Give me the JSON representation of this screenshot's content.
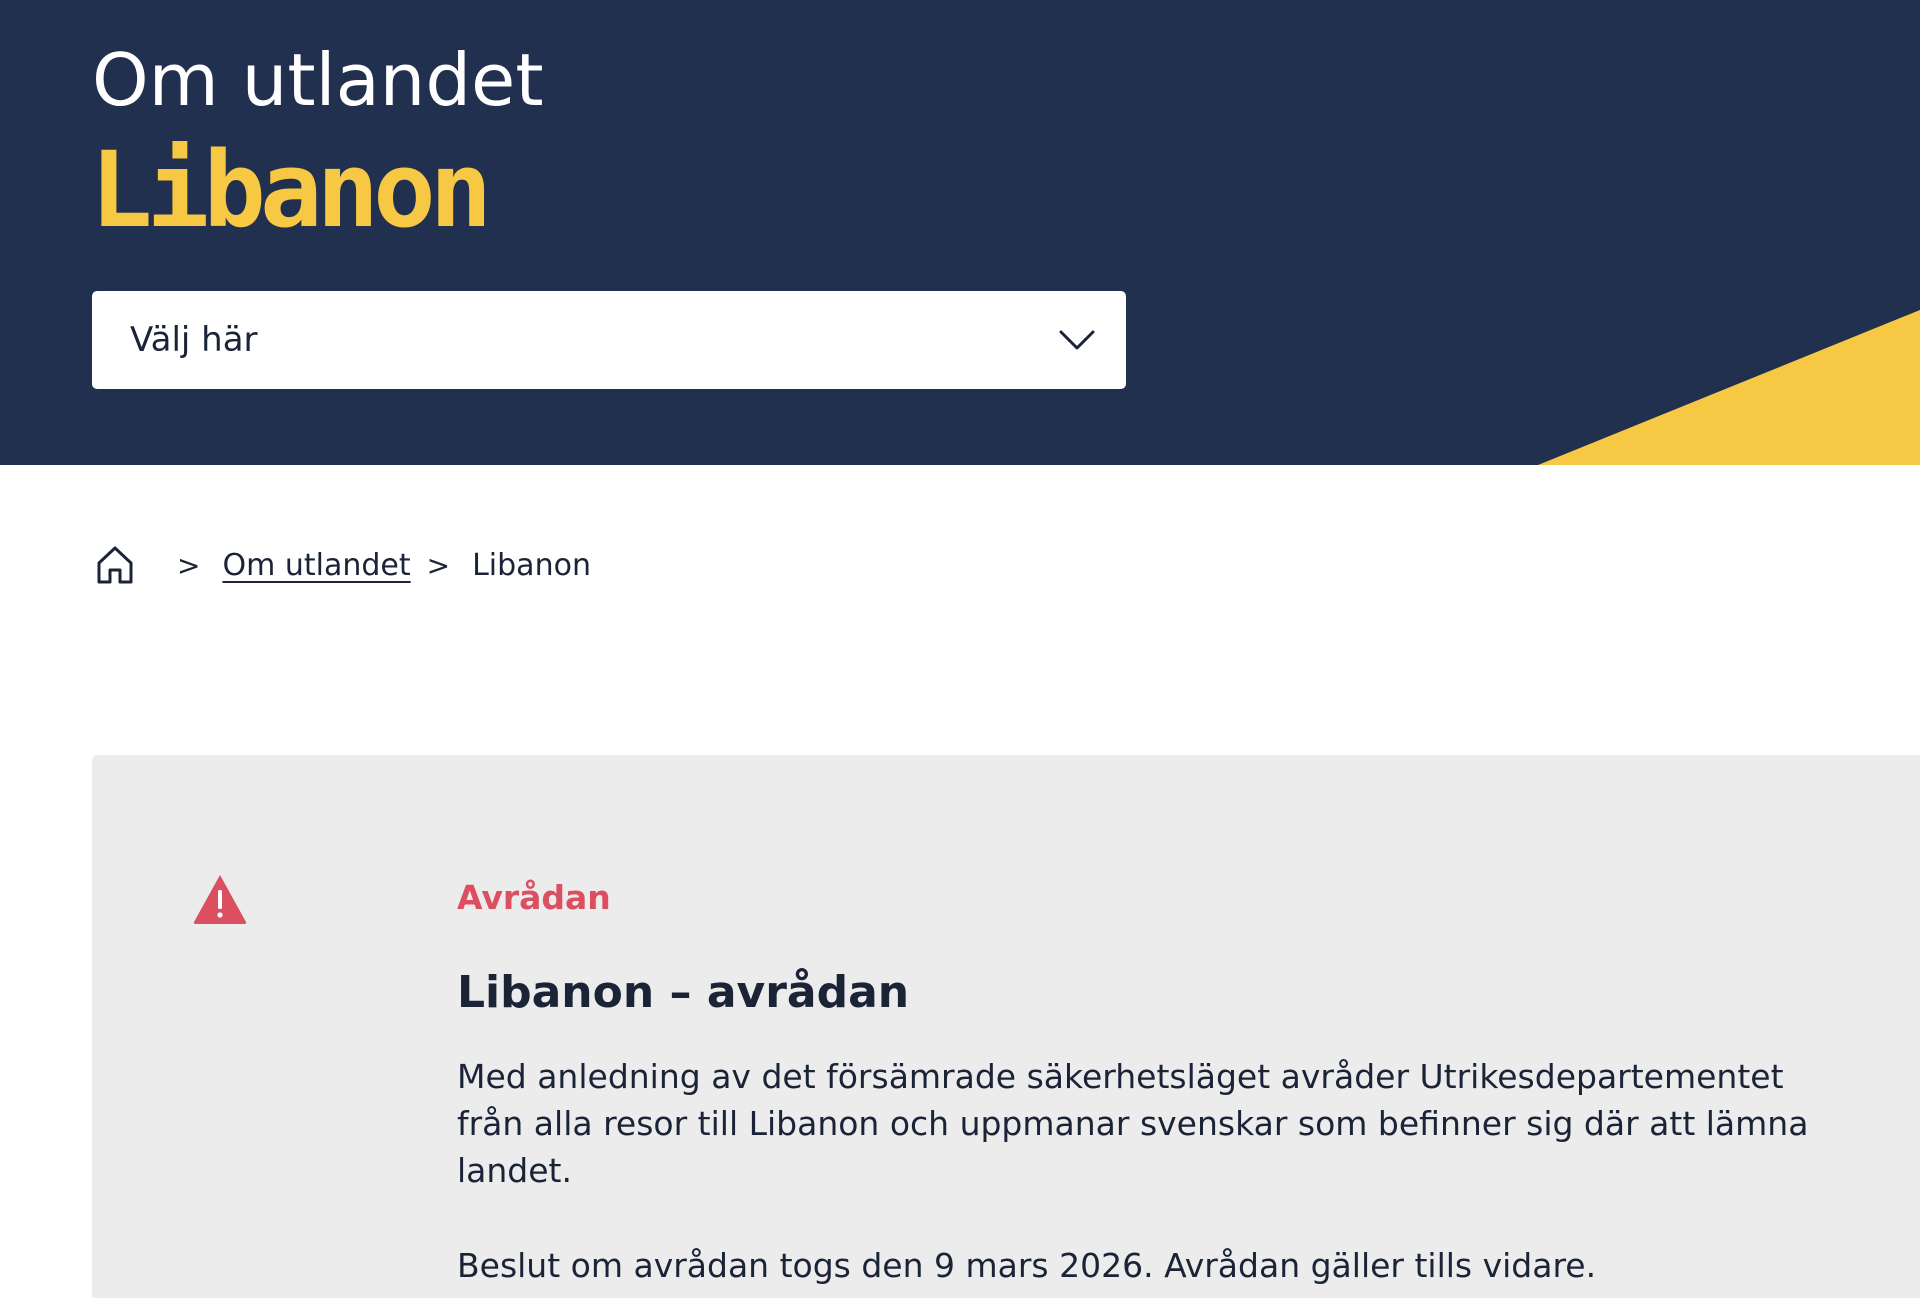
{
  "hero": {
    "kicker": "Om utlandet",
    "title": "Libanon",
    "colors": {
      "background": "#21304f",
      "accent": "#f6c844"
    },
    "select": {
      "value": "Välj här",
      "icon": "chevron-down-icon"
    }
  },
  "breadcrumb": {
    "home_icon": "home-icon",
    "separator": ">",
    "items": [
      {
        "label": "Om utlandet",
        "link": true
      },
      {
        "label": "Libanon",
        "link": false
      }
    ]
  },
  "alert": {
    "icon": "warning-icon",
    "label": "Avrådan",
    "heading": "Libanon – avrådan",
    "paragraphs": [
      "Med anledning av det försämrade säkerhetsläget avråder Utrikesdepartementet från alla resor till Libanon och uppmanar svenskar som befinner sig där att lämna landet.",
      "Beslut om avrådan togs den 9 mars 2026. Avrådan gäller tills vidare."
    ],
    "colors": {
      "panel": "#ececec",
      "warning": "#db4f60"
    }
  }
}
